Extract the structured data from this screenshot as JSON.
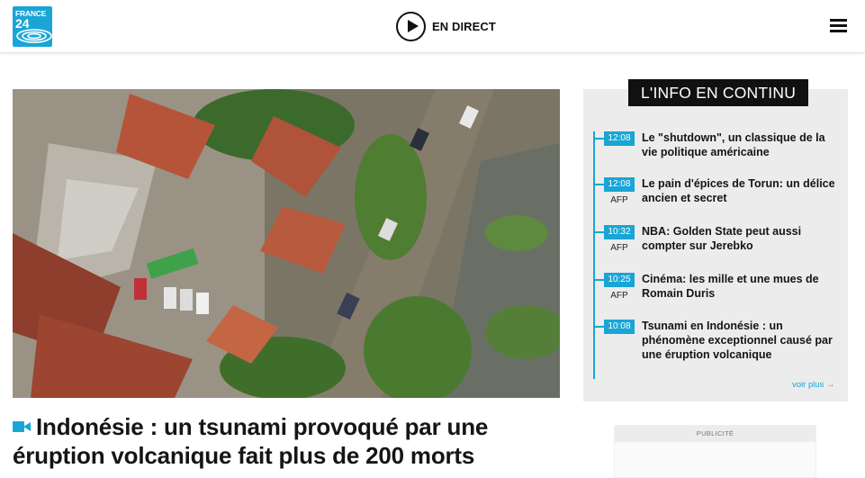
{
  "brand": {
    "line1": "FRANCE",
    "line2": "24"
  },
  "header": {
    "live_label": "EN DIRECT"
  },
  "hero": {
    "headline": "Indonésie : un tsunami provoqué par une éruption volcanique fait plus de 200 morts"
  },
  "live_feed": {
    "title": "L'INFO EN CONTINU",
    "items": [
      {
        "time": "12:08",
        "source": "",
        "title": "Le \"shutdown\", un classique de la vie politique américaine"
      },
      {
        "time": "12:08",
        "source": "AFP",
        "title": "Le pain d'épices de Torun: un délice ancien et secret"
      },
      {
        "time": "10:32",
        "source": "AFP",
        "title": "NBA: Golden State peut aussi compter sur Jerebko"
      },
      {
        "time": "10:25",
        "source": "AFP",
        "title": "Cinéma: les mille et une mues de Romain Duris"
      },
      {
        "time": "10:08",
        "source": "",
        "title": "Tsunami en Indonésie : un phénomène exceptionnel causé par une éruption volcanique"
      }
    ],
    "see_more": "voir plus →"
  },
  "ad": {
    "label": "PUBLICITÉ"
  },
  "colors": {
    "accent": "#1aa5d6",
    "panel_bg": "#ececec",
    "title_bg": "#111111"
  },
  "icons": {
    "live": "play-icon",
    "menu": "hamburger-icon",
    "video": "video-camera-icon"
  }
}
